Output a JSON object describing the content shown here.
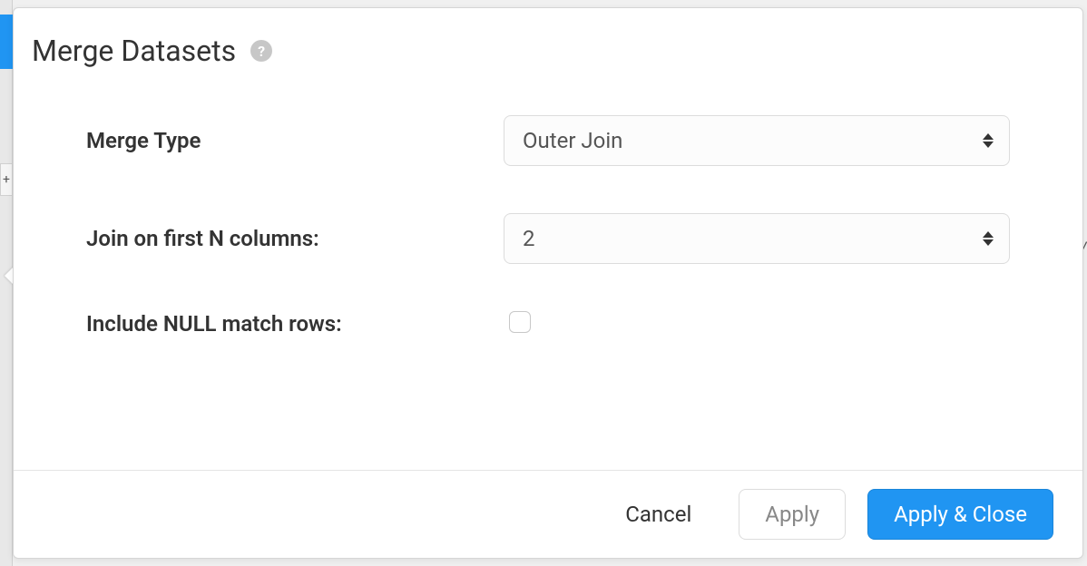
{
  "dialog": {
    "title": "Merge Datasets",
    "form": {
      "merge_type": {
        "label": "Merge Type",
        "value": "Outer Join"
      },
      "join_columns": {
        "label": "Join on first N columns:",
        "value": "2"
      },
      "include_null": {
        "label": "Include NULL match rows:",
        "checked": false
      }
    },
    "footer": {
      "cancel": "Cancel",
      "apply": "Apply",
      "apply_close": "Apply & Close"
    }
  }
}
